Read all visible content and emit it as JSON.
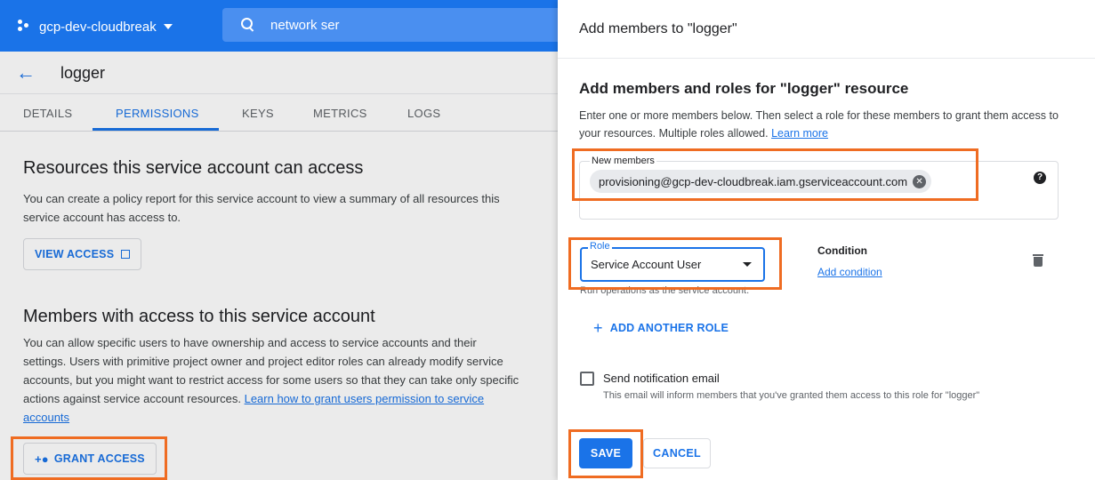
{
  "console": {
    "project_name": "gcp-dev-cloudbreak",
    "search_value": "network ser",
    "page_title": "logger",
    "tabs": [
      "DETAILS",
      "PERMISSIONS",
      "KEYS",
      "METRICS",
      "LOGS"
    ],
    "active_tab": "PERMISSIONS",
    "resources_heading": "Resources this service account can access",
    "resources_desc": "You can create a policy report for this service account to view a summary of all resources this service account has access to.",
    "view_access_label": "VIEW ACCESS",
    "members_heading": "Members with access to this service account",
    "members_desc": "You can allow specific users to have ownership and access to service accounts and their settings. Users with primitive project owner and project editor roles can already modify service accounts, but you might want to restrict access for some users so that they can take only specific actions against service account resources.",
    "members_link": "Learn how to grant users permission to service accounts",
    "grant_access_label": "GRANT ACCESS"
  },
  "panel": {
    "title": "Add members to \"logger\"",
    "section_title": "Add members and roles for \"logger\" resource",
    "section_desc": "Enter one or more members below. Then select a role for these members to grant them access to your resources. Multiple roles allowed.",
    "learn_more": "Learn more",
    "new_members_label": "New members",
    "member_chip": "provisioning@gcp-dev-cloudbreak.iam.gserviceaccount.com",
    "role_label": "Role",
    "role_value": "Service Account User",
    "role_hint": "Run operations as the service account.",
    "condition_label": "Condition",
    "add_condition": "Add condition",
    "add_another_role": "ADD ANOTHER ROLE",
    "notify_label": "Send notification email",
    "notify_desc": "This email will inform members that you've granted them access to this role for \"logger\"",
    "save_label": "SAVE",
    "cancel_label": "CANCEL"
  },
  "colors": {
    "primary": "#1a73e8",
    "highlight": "#ef6c22"
  }
}
